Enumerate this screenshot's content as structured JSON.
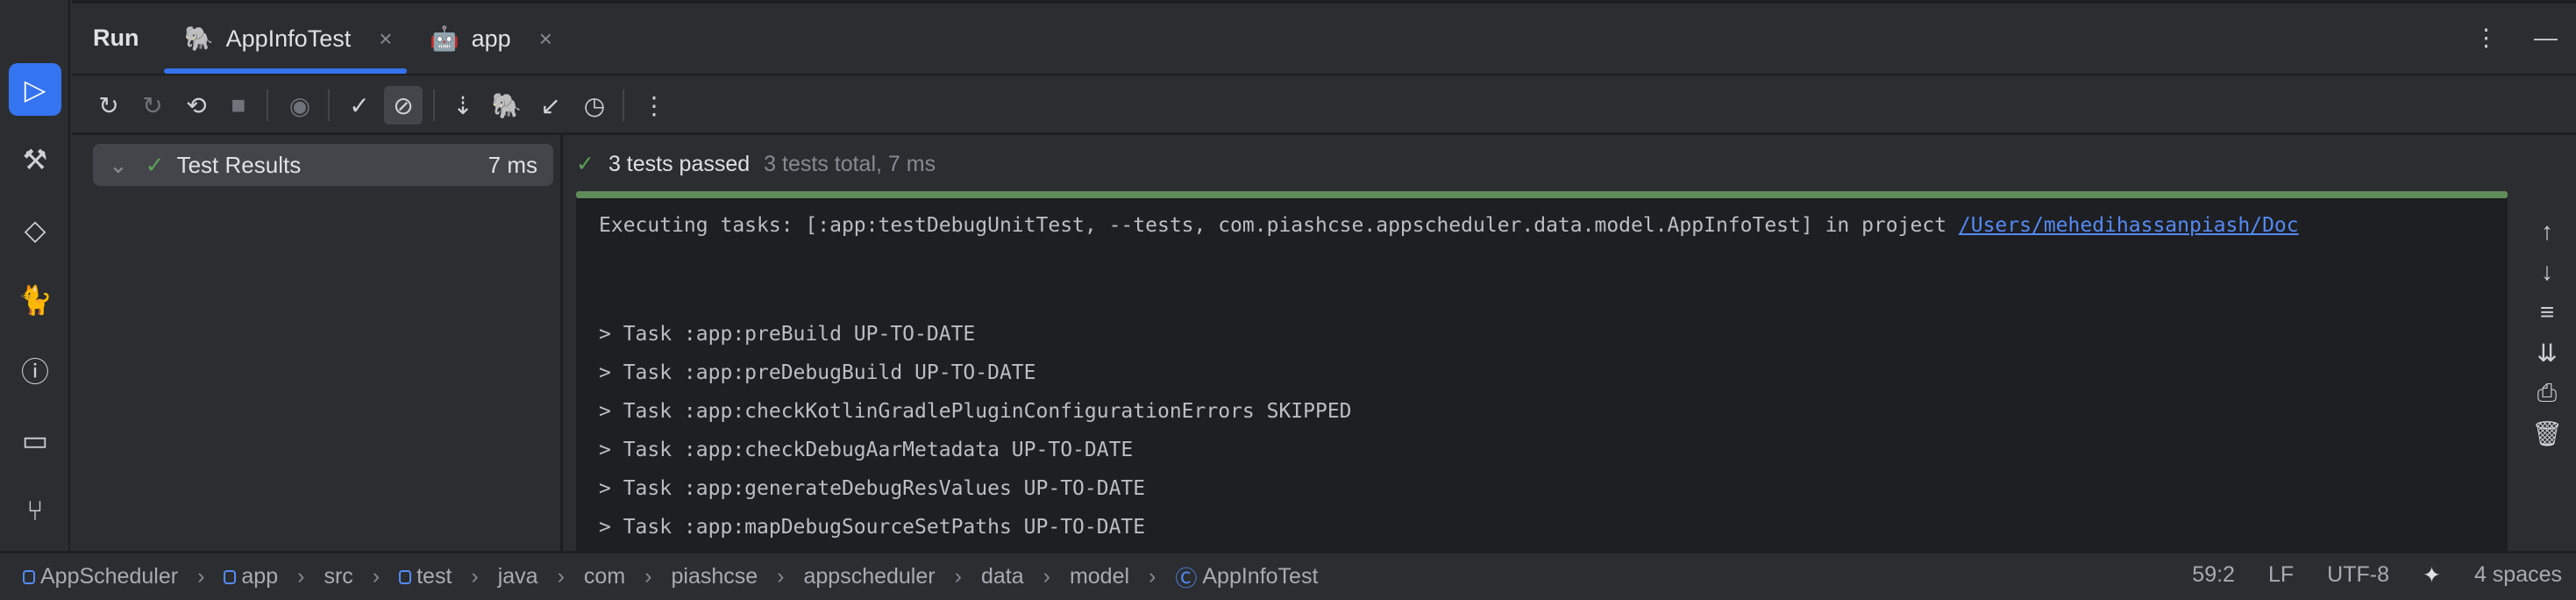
{
  "tabs": {
    "run_label": "Run",
    "items": [
      {
        "label": "AppInfoTest",
        "icon": "gradle-icon"
      },
      {
        "label": "app",
        "icon": "android-icon"
      }
    ]
  },
  "tree": {
    "root_label": "Test Results",
    "root_time": "7 ms"
  },
  "summary": {
    "passed": "3 tests passed",
    "total": "3 tests total, 7 ms"
  },
  "progress": {
    "percent": 100,
    "color": "#5f8c5a"
  },
  "console": {
    "exec_prefix": "Executing tasks: [:app:testDebugUnitTest, --tests, com.piashcse.appscheduler.data.model.AppInfoTest] in project ",
    "exec_link": "/Users/mehedihassanpiash/Doc",
    "lines": [
      "> Task :app:preBuild UP-TO-DATE",
      "> Task :app:preDebugBuild UP-TO-DATE",
      "> Task :app:checkKotlinGradlePluginConfigurationErrors SKIPPED",
      "> Task :app:checkDebugAarMetadata UP-TO-DATE",
      "> Task :app:generateDebugResValues UP-TO-DATE",
      "> Task :app:mapDebugSourceSetPaths UP-TO-DATE"
    ]
  },
  "breadcrumb": [
    "AppScheduler",
    "app",
    "src",
    "test",
    "java",
    "com",
    "piashcse",
    "appscheduler",
    "data",
    "model",
    "AppInfoTest"
  ],
  "status": {
    "position": "59:2",
    "line_sep": "LF",
    "encoding": "UTF-8",
    "indent": "4 spaces"
  },
  "colors": {
    "accent": "#3574f0",
    "success": "#5f9e5a"
  }
}
